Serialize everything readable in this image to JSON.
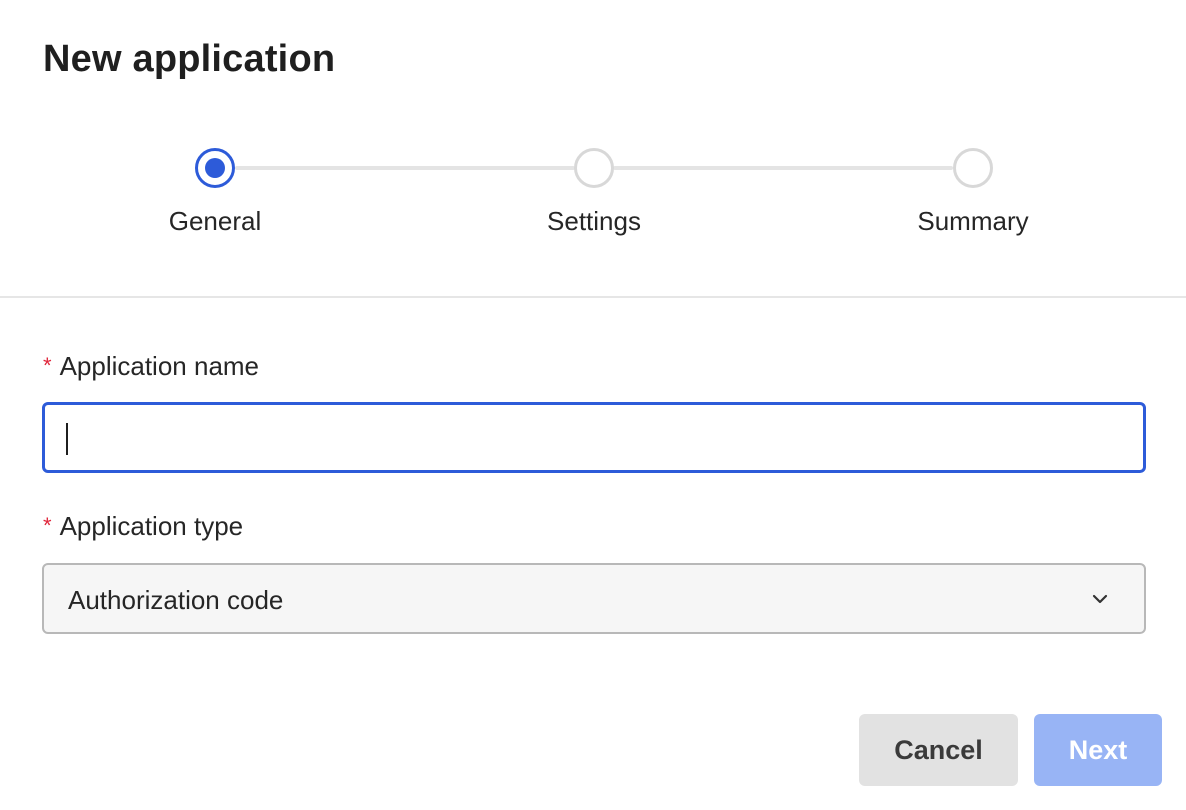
{
  "dialog": {
    "title": "New application"
  },
  "stepper": {
    "steps": [
      {
        "label": "General",
        "state": "active"
      },
      {
        "label": "Settings",
        "state": "inactive"
      },
      {
        "label": "Summary",
        "state": "inactive"
      }
    ]
  },
  "form": {
    "application_name": {
      "required_marker": "*",
      "label": "Application name",
      "value": "",
      "focused": true
    },
    "application_type": {
      "required_marker": "*",
      "label": "Application type",
      "selected": "Authorization code"
    }
  },
  "actions": {
    "cancel_label": "Cancel",
    "next_label": "Next",
    "next_disabled": true
  },
  "colors": {
    "accent": "#2d5bd9",
    "required": "#e0263b",
    "next_disabled_bg": "#98b4f5",
    "cancel_bg": "#e2e2e2"
  },
  "icons": {
    "select_chevron": "chevron-down-icon"
  }
}
